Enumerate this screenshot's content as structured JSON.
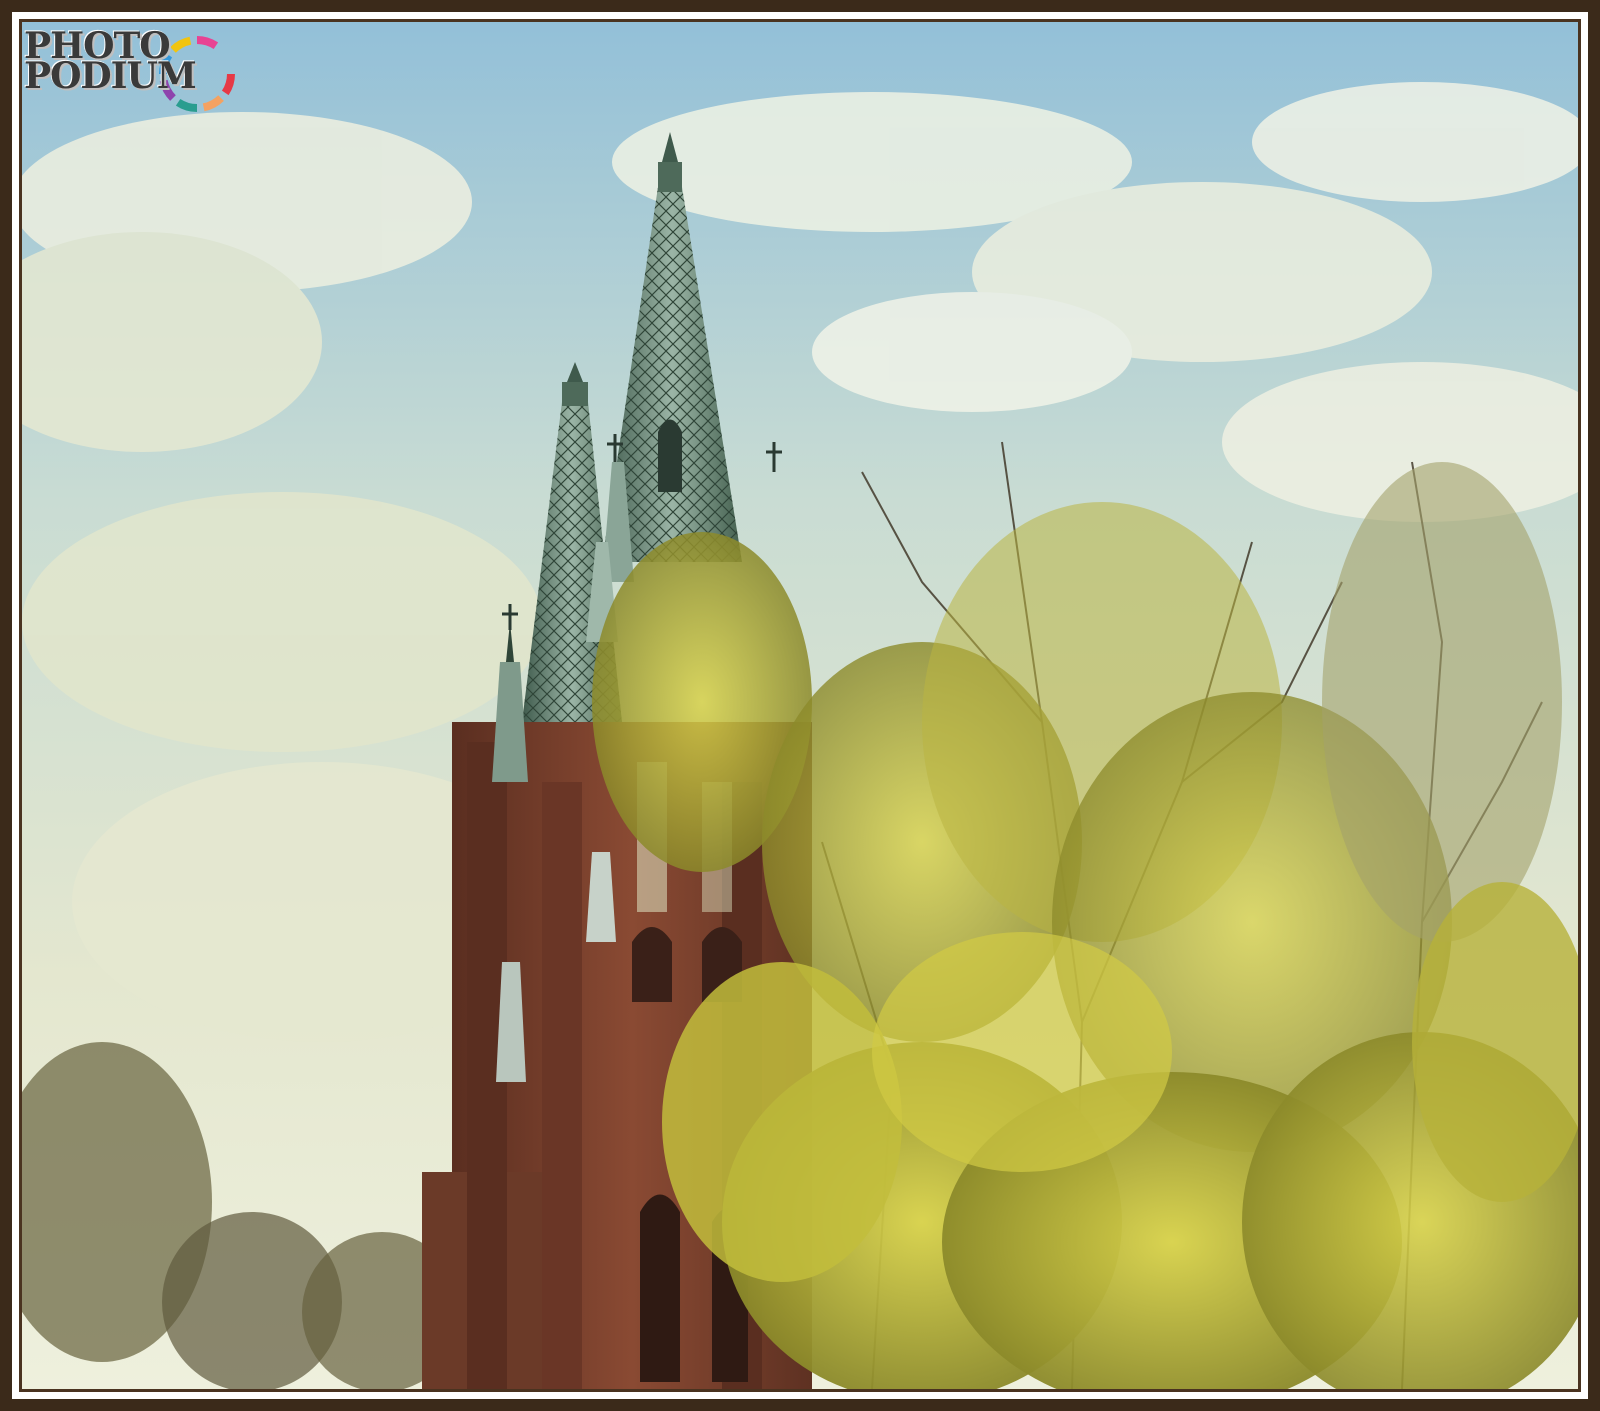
{
  "logo": {
    "line1": "PHOTO",
    "line2": "PODIUM",
    "ring_colors": [
      "#e63946",
      "#f4a261",
      "#2a9d8f",
      "#8e44ad",
      "#3498db",
      "#f1c40f",
      "#e84393"
    ]
  },
  "colors": {
    "frame": "#3b2a1a",
    "sky_top": "#9cc4d6",
    "sky_bottom": "#e7ead2",
    "brick": "#7a3f2b",
    "spire": "#6f8a7a",
    "foliage": "#c9c23a"
  }
}
